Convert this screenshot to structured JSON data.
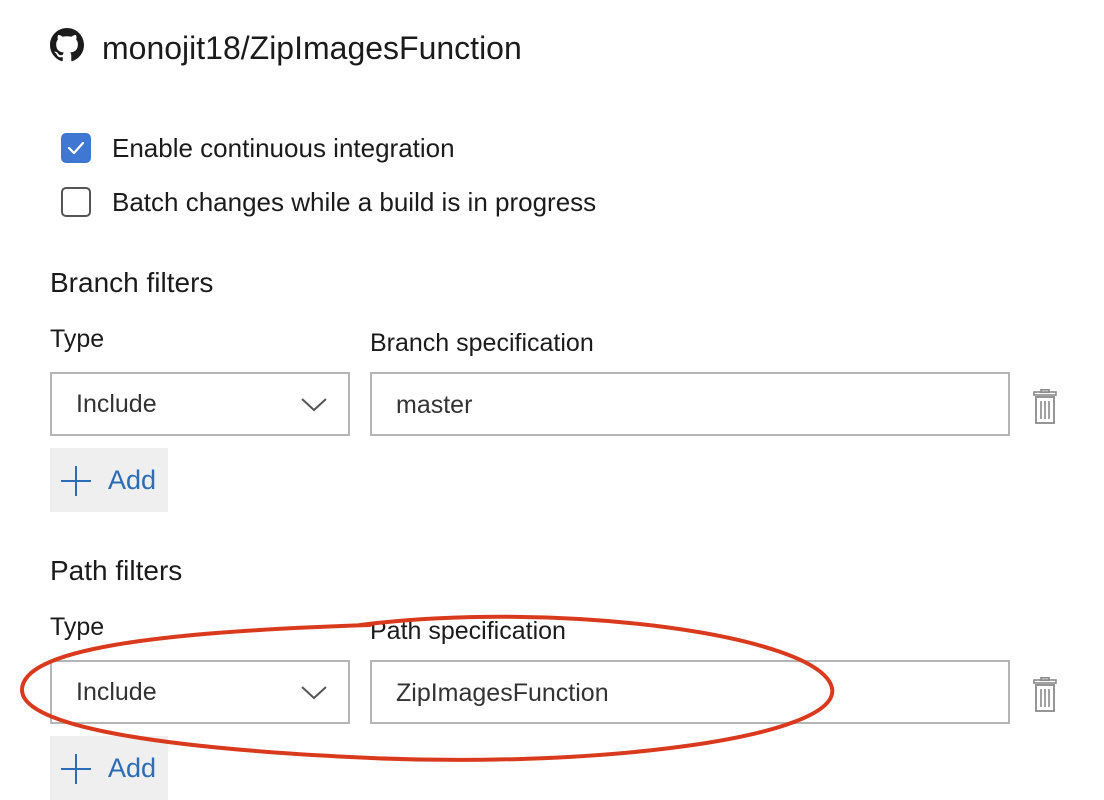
{
  "repo": {
    "icon": "github-icon",
    "name": "monojit18/ZipImagesFunction"
  },
  "options": [
    {
      "label": "Enable continuous integration",
      "checked": true
    },
    {
      "label": "Batch changes while a build is in progress",
      "checked": false
    }
  ],
  "branch_filters": {
    "title": "Branch filters",
    "type_label": "Type",
    "spec_label": "Branch specification",
    "type_value": "Include",
    "spec_value": "master",
    "add_label": "Add"
  },
  "path_filters": {
    "title": "Path filters",
    "type_label": "Type",
    "spec_label": "Path specification",
    "type_value": "Include",
    "spec_value": "ZipImagesFunction",
    "add_label": "Add"
  },
  "colors": {
    "accent": "#3f77d3",
    "link": "#2c6cb5",
    "annotation": "#d93a1e",
    "border": "#b5b5b5"
  }
}
